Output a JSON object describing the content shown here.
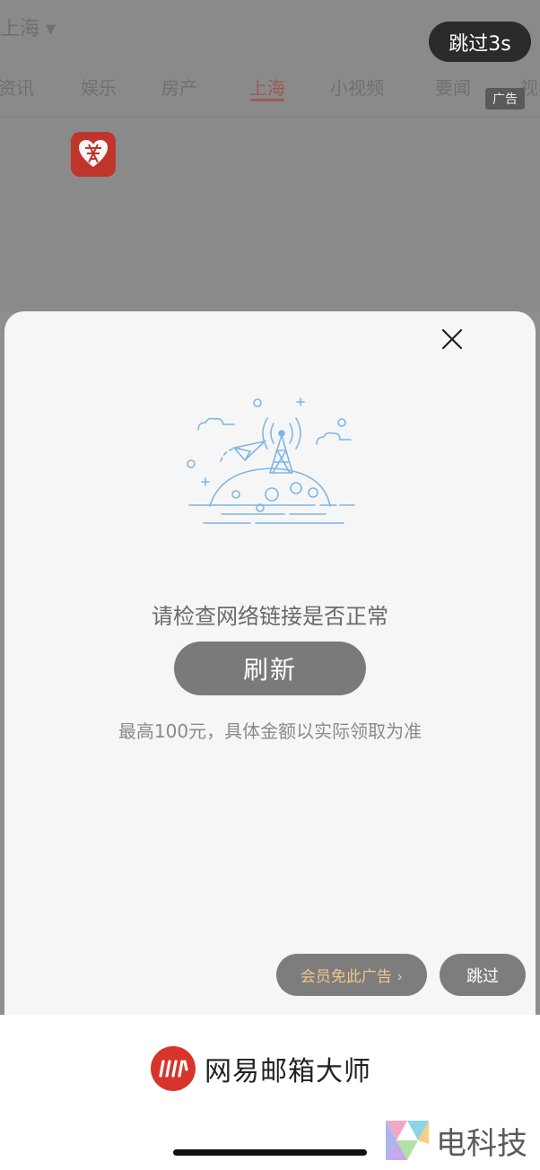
{
  "background": {
    "location": "上海 ▾",
    "tabs": [
      "资讯",
      "娱乐",
      "房产",
      "上海",
      "小视频",
      "要闻",
      "视频"
    ]
  },
  "ad": {
    "skip_countdown": "跳过3s",
    "ad_label": "广告"
  },
  "modal": {
    "message": "请检查网络链接是否正常",
    "refresh_label": "刷新",
    "note": "最高100元，具体金额以实际领取为准",
    "vip_label": "会员免此广告 ›",
    "skip_label": "跳过"
  },
  "footer": {
    "brand_name": "网易邮箱大师",
    "watermark": "电科技"
  },
  "colors": {
    "brand_red": "#d8342c",
    "vip_text": "#f3c48a",
    "illustration_blue": "#7db6e8"
  }
}
